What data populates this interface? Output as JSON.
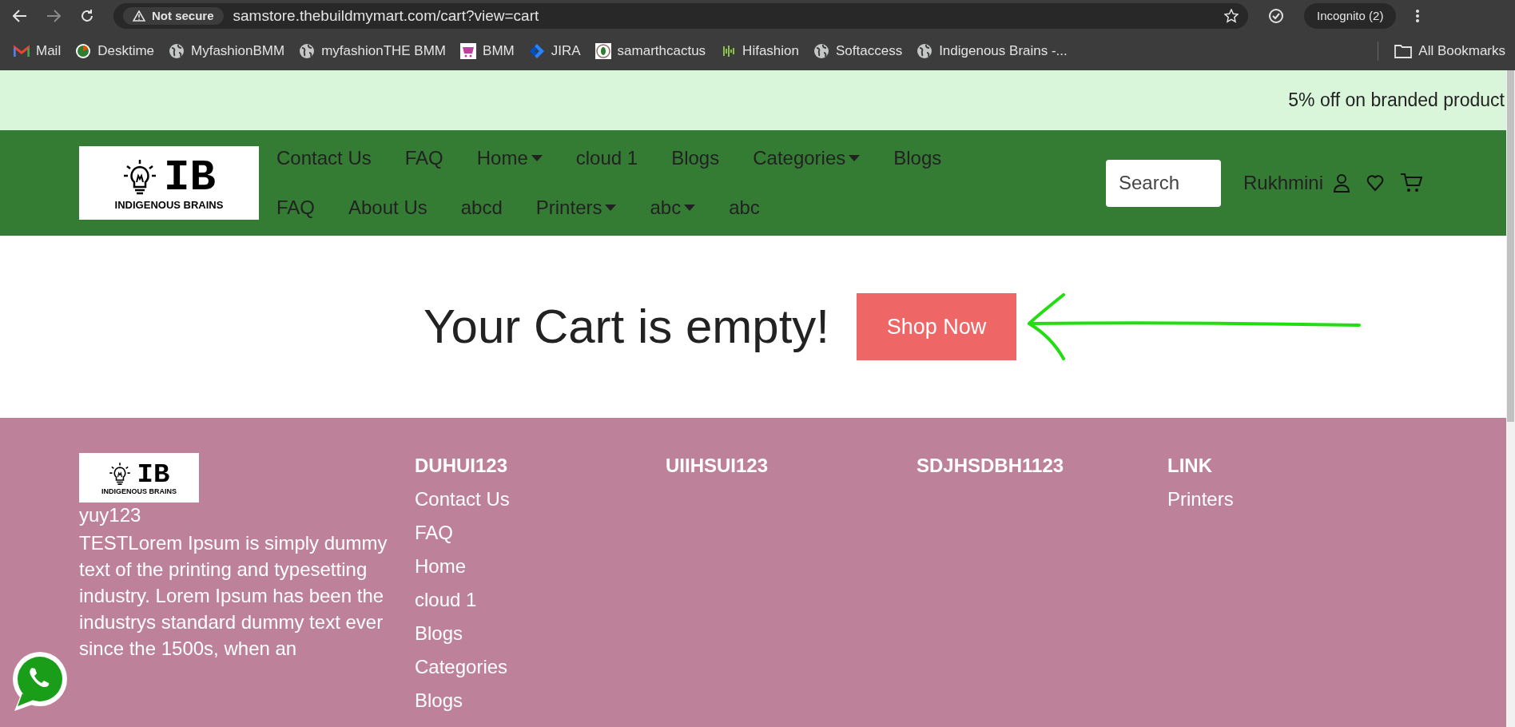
{
  "browser": {
    "security": "Not secure",
    "url": "samstore.thebuildmymart.com/cart?view=cart",
    "profile": "Incognito (2)",
    "bookmarks": [
      {
        "label": "Mail",
        "kind": "mail"
      },
      {
        "label": "Desktime",
        "kind": "clock"
      },
      {
        "label": "MyfashionBMM",
        "kind": "globe"
      },
      {
        "label": "myfashionTHE BMM",
        "kind": "globe"
      },
      {
        "label": "BMM",
        "kind": "cart"
      },
      {
        "label": "JIRA",
        "kind": "jira"
      },
      {
        "label": "samarthcactus",
        "kind": "leaf"
      },
      {
        "label": "Hifashion",
        "kind": "wave"
      },
      {
        "label": "Softaccess",
        "kind": "globe"
      },
      {
        "label": "Indigenous Brains -...",
        "kind": "globe"
      }
    ],
    "all_bookmarks": "All Bookmarks"
  },
  "banner": {
    "text": "5% off on branded product"
  },
  "header": {
    "logo": {
      "mark": "IB",
      "caption": "INDIGENOUS BRAINS"
    },
    "nav_rows": [
      [
        {
          "label": "Contact Us",
          "dropdown": false
        },
        {
          "label": "FAQ",
          "dropdown": false
        },
        {
          "label": "Home",
          "dropdown": true
        },
        {
          "label": "cloud 1",
          "dropdown": false
        },
        {
          "label": "Blogs",
          "dropdown": false
        },
        {
          "label": "Categories",
          "dropdown": true
        },
        {
          "label": "Blogs",
          "dropdown": false
        }
      ],
      [
        {
          "label": "FAQ",
          "dropdown": false
        },
        {
          "label": "About Us",
          "dropdown": false
        },
        {
          "label": "abcd",
          "dropdown": false
        },
        {
          "label": "Printers",
          "dropdown": true
        },
        {
          "label": "abc",
          "dropdown": true
        },
        {
          "label": "abc",
          "dropdown": false
        }
      ]
    ],
    "search": {
      "placeholder": "Search"
    },
    "user": "Rukhmini"
  },
  "main": {
    "heading": "Your Cart is empty!",
    "button": "Shop Now"
  },
  "footer": {
    "logo": {
      "mark": "IB",
      "caption": "INDIGENOUS BRAINS"
    },
    "brand": "yuy123",
    "description": "TESTLorem Ipsum is simply dummy text of the printing and typesetting industry. Lorem Ipsum has been the industrys standard dummy text ever since the 1500s, when an",
    "columns": [
      {
        "heading": "DUHUI123",
        "links": [
          "Contact Us",
          "FAQ",
          "Home",
          "cloud 1",
          "Blogs",
          "Categories",
          "Blogs"
        ]
      },
      {
        "heading": "UIIHSUI123"
      },
      {
        "heading": "SDJHSDBH1123"
      },
      {
        "heading": "LINK",
        "links": [
          "Printers"
        ]
      }
    ]
  }
}
